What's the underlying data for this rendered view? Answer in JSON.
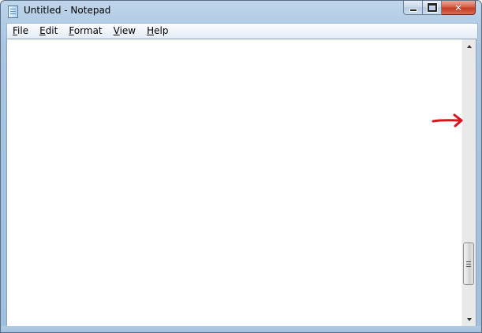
{
  "window": {
    "title": "Untitled - Notepad"
  },
  "menu": {
    "items": [
      {
        "label_rest": "ile",
        "access_key": "F"
      },
      {
        "label_rest": "dit",
        "access_key": "E"
      },
      {
        "label_rest": "ormat",
        "access_key": "F"
      },
      {
        "label_rest": "iew",
        "access_key": "V"
      },
      {
        "label_rest": "elp",
        "access_key": "H"
      }
    ]
  },
  "editor": {
    "content": ""
  },
  "icons": {
    "app": "notepad-icon",
    "minimize": "minimize-icon",
    "maximize": "maximize-icon",
    "close": "close-icon",
    "scroll_up": "arrow-up-icon",
    "scroll_down": "arrow-down-icon",
    "thumb_grip": "grip-icon",
    "annotation": "red-arrow-icon"
  },
  "colors": {
    "annotation_arrow": "#d8141c",
    "close_button": "#c43d24"
  }
}
